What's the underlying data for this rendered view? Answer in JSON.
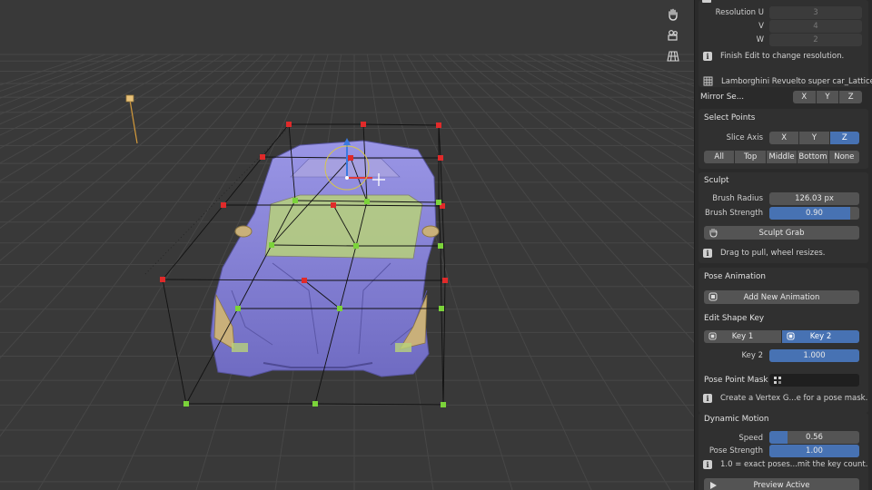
{
  "viewport": {
    "icons": [
      "hand-pan-icon",
      "camera-icon",
      "grid-view-icon"
    ]
  },
  "sidebar": {
    "resolution": {
      "u_label": "Resolution U",
      "u_value": "3",
      "v_label": "V",
      "v_value": "4",
      "w_label": "W",
      "w_value": "2"
    },
    "finish_edit_note": "Finish Edit to change resolution.",
    "object_name": "Lamborghini Revuelto super car_Lattice",
    "mirror": {
      "label": "Mirror Se...",
      "axes": [
        "X",
        "Y",
        "Z"
      ]
    },
    "select_points": {
      "title": "Select Points",
      "slice_axis_label": "Slice Axis",
      "slice_axes": [
        "X",
        "Y",
        "Z"
      ],
      "slice_active": "Z",
      "presets": [
        "All",
        "Top",
        "Middle",
        "Bottom",
        "None"
      ]
    },
    "sculpt": {
      "title": "Sculpt",
      "brush_radius_label": "Brush Radius",
      "brush_radius_value": "126.03 px",
      "brush_strength_label": "Brush Strength",
      "brush_strength_value": "0.90",
      "brush_strength_fraction": 0.9,
      "grab_button": "Sculpt Grab",
      "hint": "Drag to pull, wheel resizes."
    },
    "pose_animation": {
      "title": "Pose Animation",
      "add_button": "Add New Animation",
      "shape_key_title": "Edit Shape Key",
      "keys": [
        "Key 1",
        "Key 2"
      ],
      "active_key": "Key 2",
      "key_value_label": "Key 2",
      "key_value": "1.000",
      "key_value_fraction": 1.0,
      "mask_label": "Pose Point Mask",
      "mask_hint": "Create a Vertex G...e for a pose mask."
    },
    "dynamic_motion": {
      "title": "Dynamic Motion",
      "speed_label": "Speed",
      "speed_value": "0.56",
      "speed_fraction": 0.2,
      "pose_strength_label": "Pose Strength",
      "pose_strength_value": "1.00",
      "pose_strength_fraction": 1.0,
      "hint": "1.0 = exact poses...mit the key count.",
      "preview_button": "Preview Active"
    }
  },
  "colors": {
    "accent": "#4772b3",
    "lattice_selected": "#7bd33a",
    "lattice_unselected": "#e02a2a",
    "car_body": "#8a86d6"
  }
}
